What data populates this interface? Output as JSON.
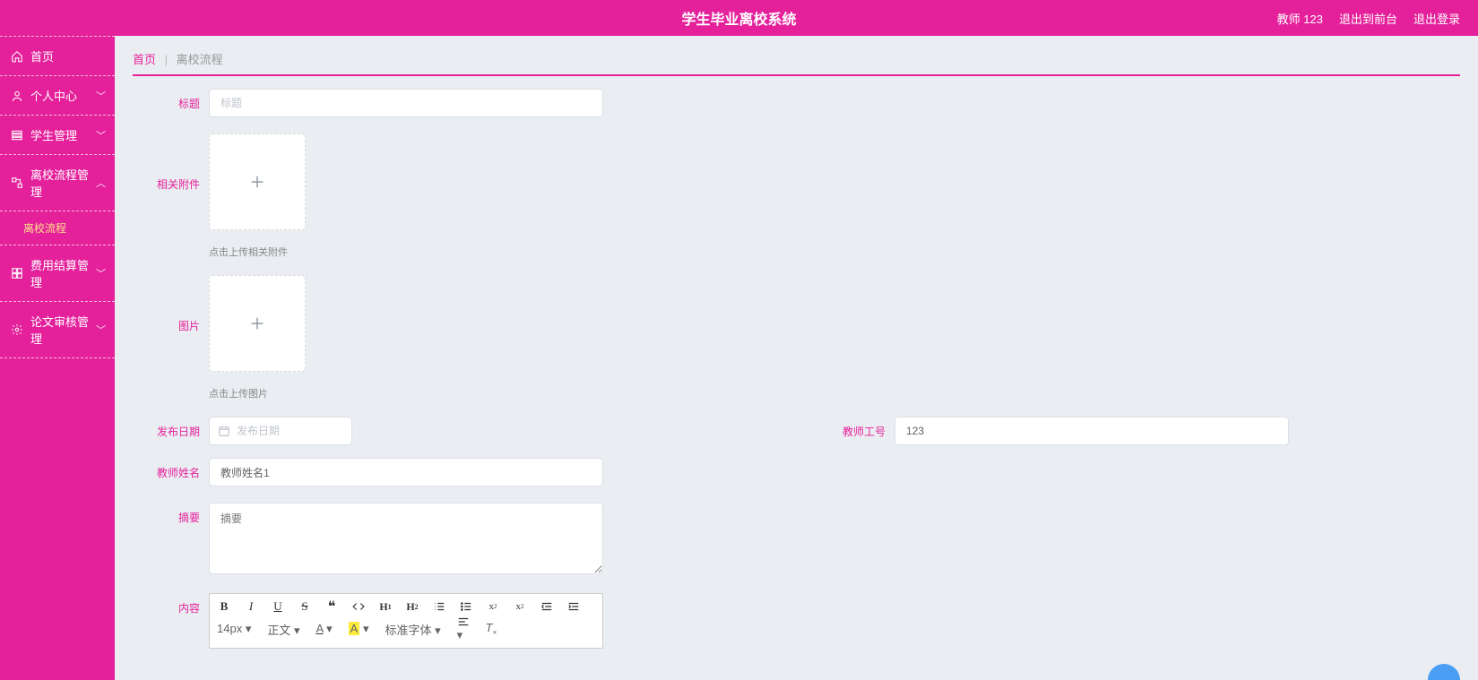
{
  "header": {
    "title": "学生毕业离校系统",
    "user_label": "教师 123",
    "exit_front": "退出到前台",
    "logout": "退出登录"
  },
  "sidebar": {
    "items": [
      {
        "icon": "home-icon",
        "label": "首页"
      },
      {
        "icon": "user-icon",
        "label": "个人中心",
        "expand": "collapsed"
      },
      {
        "icon": "list-icon",
        "label": "学生管理",
        "expand": "collapsed"
      },
      {
        "icon": "flow-icon",
        "label": "离校流程管理",
        "expand": "expanded",
        "sub": [
          {
            "label": "离校流程"
          }
        ]
      },
      {
        "icon": "grid-icon",
        "label": "费用结算管理",
        "expand": "collapsed"
      },
      {
        "icon": "cog-icon",
        "label": "论文审核管理",
        "expand": "collapsed"
      }
    ]
  },
  "breadcrumb": {
    "home": "首页",
    "sep": "|",
    "current": "离校流程"
  },
  "form": {
    "title_label": "标题",
    "title_placeholder": "标题",
    "attachment_label": "相关附件",
    "attachment_hint": "点击上传相关附件",
    "image_label": "图片",
    "image_hint": "点击上传图片",
    "publish_date_label": "发布日期",
    "publish_date_placeholder": "发布日期",
    "teacher_id_label": "教师工号",
    "teacher_id_value": "123",
    "teacher_name_label": "教师姓名",
    "teacher_name_value": "教师姓名1",
    "summary_label": "摘要",
    "summary_placeholder": "摘要",
    "content_label": "内容"
  },
  "editor": {
    "font_size": "14px",
    "font_style": "正文",
    "font_family": "标准字体"
  }
}
